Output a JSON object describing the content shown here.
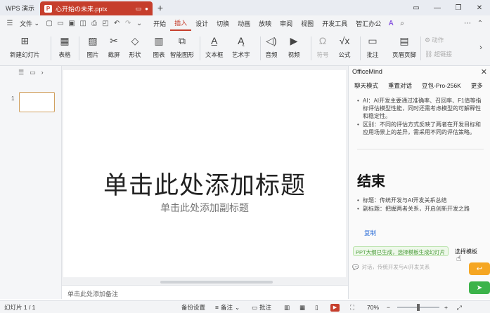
{
  "titlebar": {
    "app_name": "WPS 演示",
    "doc_tab": "心开始の未来.pptx",
    "new_tab": "+",
    "min_glyph": "—",
    "max_glyph": "❐",
    "close_glyph": "✕"
  },
  "menubar": {
    "file": "文件",
    "items": [
      "开始",
      "插入",
      "设计",
      "切换",
      "动画",
      "放映",
      "审阅",
      "视图",
      "开发工具",
      "智汇办公"
    ],
    "active_index": 1
  },
  "ribbon": {
    "new_slide": "新建幻灯片",
    "table": "表格",
    "picture": "图片",
    "screenshot": "截屏",
    "shape": "形状",
    "chart": "图表",
    "smartart": "智能图形",
    "textbox": "文本框",
    "wordart": "艺术字",
    "audio": "音频",
    "video": "视频",
    "symbol": "符号",
    "formula": "公式",
    "comment": "批注",
    "header_footer": "页眉页脚",
    "action": "动作",
    "hyperlink": "超链接"
  },
  "thumbnails": {
    "slide_number": "1"
  },
  "slide": {
    "title_placeholder": "单击此处添加标题",
    "subtitle_placeholder": "单击此处添加副标题"
  },
  "notes": {
    "placeholder": "单击此处添加备注"
  },
  "panel": {
    "title": "OfficeMind",
    "tabs": [
      "聊天模式",
      "重置对话",
      "豆包-Pro-256K",
      "更多"
    ],
    "bullets_top": [
      "AI：AI开发主要通过准确率、召回率、F1值等指标评估模型性能，同时还需考虑模型的可解释性和稳定性。",
      "区别：不同的评估方式反映了两者在开发目标和应用场景上的差异，需采用不同的评估策略。"
    ],
    "section_title": "结束",
    "bullets_end": [
      "标题：传统开发与AI开发关系总结",
      "副标题：把握两者关系，开启创新开发之路"
    ],
    "copy": "复制",
    "suggestion": "PPT大纲已生成，选择模板生成幻灯片",
    "choose_template": "选择模板",
    "input_placeholder": "对话，传统开发与AI开发关系",
    "colors": {
      "send_orange": "#f5a623",
      "send_green": "#3cb34a",
      "suggest_green": "#4a9a3a"
    }
  },
  "statusbar": {
    "slide_count": "幻灯片 1 / 1",
    "backup": "备份设置",
    "notes": "备注",
    "comment": "批注",
    "zoom": "70%"
  },
  "accent_color": "#c63e2c"
}
